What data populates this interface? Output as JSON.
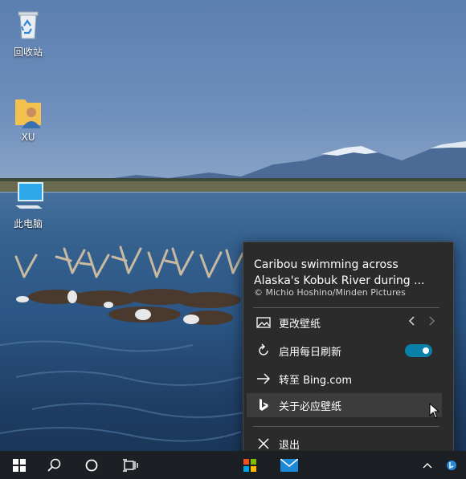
{
  "desktop": {
    "icons": [
      {
        "label": "回收站",
        "icon": "recycle-bin-icon"
      },
      {
        "label": "XU",
        "icon": "user-folder-icon"
      },
      {
        "label": "此电脑",
        "icon": "this-pc-icon"
      }
    ]
  },
  "menu": {
    "title": "Caribou swimming across Alaska's Kobuk River during ...",
    "credit": "© Michio Hoshino/Minden Pictures",
    "items": [
      {
        "label": "更改壁纸",
        "icon": "image-icon"
      },
      {
        "label": "启用每日刷新",
        "icon": "refresh-icon",
        "toggle_on": true
      },
      {
        "label": "转至 Bing.com",
        "icon": "arrow-right-icon"
      },
      {
        "label": "关于必应壁纸",
        "icon": "bing-logo-icon"
      },
      {
        "label": "退出",
        "icon": "close-icon"
      }
    ]
  },
  "taskbar": {
    "buttons": [
      "start-icon",
      "search-icon",
      "cortana-icon",
      "task-view-icon",
      "bing-wallpaper-app-icon",
      "mail-icon"
    ]
  },
  "colors": {
    "accent": "#0a7fa8",
    "menu_bg": "#2b2b2b",
    "taskbar_bg": "#1c1f24"
  }
}
